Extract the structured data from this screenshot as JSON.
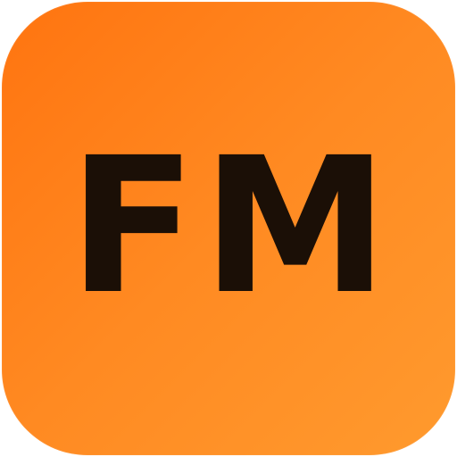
{
  "app_icon": {
    "label": "FM",
    "background_gradient": [
      "#ff7410",
      "#ff8a22",
      "#ff9a2e"
    ],
    "text_color": "#1b0f06"
  }
}
